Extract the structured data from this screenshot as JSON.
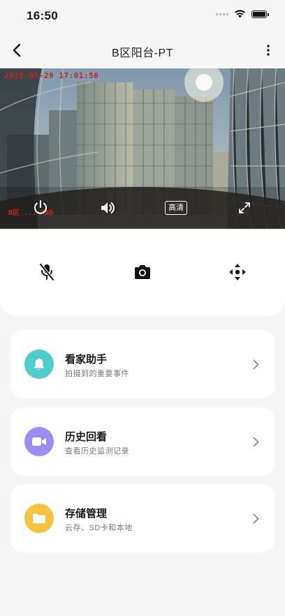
{
  "status_bar": {
    "time": "16:50"
  },
  "nav": {
    "title": "B区阳台-PT"
  },
  "video": {
    "osd_time": "2020-05-29 17:01:50",
    "osd_name": "B区 ... 40D",
    "hd_label": "高清"
  },
  "cards": [
    {
      "title": "看家助手",
      "subtitle": "拍摄到的重要事件",
      "icon": "bell-icon",
      "color": "#4fcdcd"
    },
    {
      "title": "历史回看",
      "subtitle": "查看历史监测记录",
      "icon": "video-camera-icon",
      "color": "#9d8df2"
    },
    {
      "title": "存储管理",
      "subtitle": "云存、SD卡和本地",
      "icon": "folder-icon",
      "color": "#f8c23f"
    }
  ]
}
